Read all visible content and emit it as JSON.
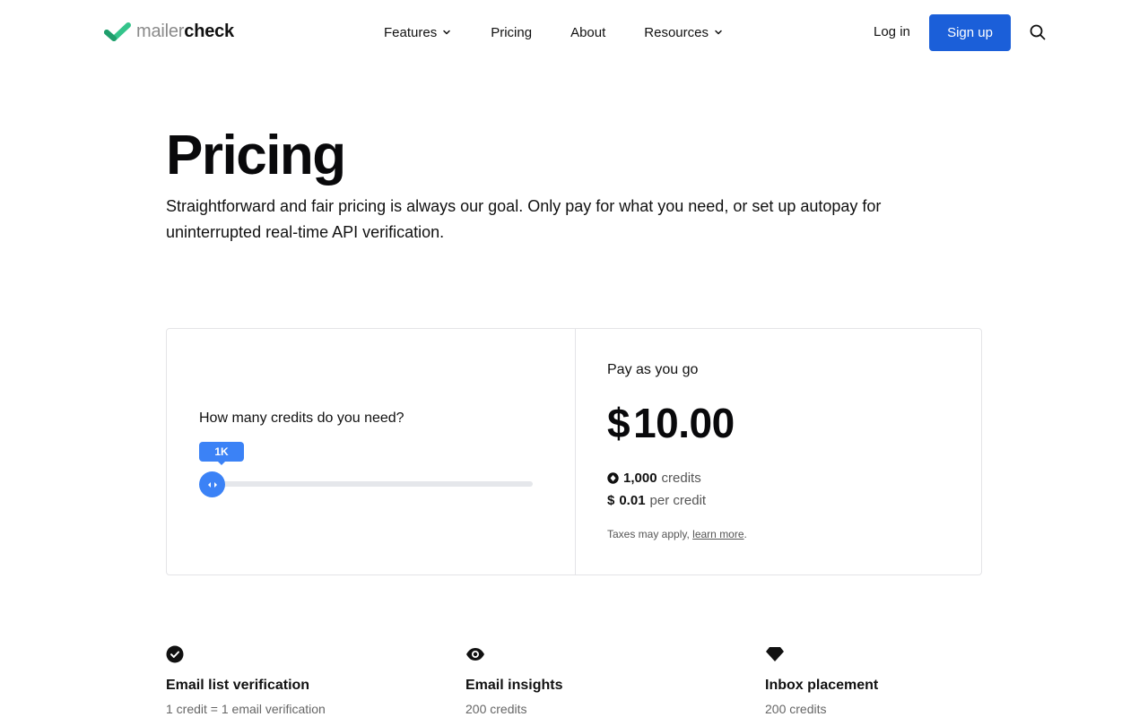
{
  "nav": {
    "logo_light": "mailer",
    "logo_dark": "check",
    "links": [
      {
        "label": "Features",
        "has_dropdown": true
      },
      {
        "label": "Pricing",
        "has_dropdown": false
      },
      {
        "label": "About",
        "has_dropdown": false
      },
      {
        "label": "Resources",
        "has_dropdown": true
      }
    ],
    "login_label": "Log in",
    "signup_label": "Sign up",
    "search_icon": "search-icon"
  },
  "hero": {
    "title": "Pricing",
    "subtitle": "Straightforward and fair pricing is always our goal. Only pay for what you need, or set up autopay for uninterrupted real-time API verification."
  },
  "calculator": {
    "question": "How many credits do you need?",
    "slider": {
      "tooltip": "1K",
      "level_fraction": 0
    },
    "plan_label": "Pay as you go",
    "currency": "$",
    "price": "10.00",
    "credits_value": "1,000",
    "credits_label": "credits",
    "per_credit_currency": "$",
    "per_credit_value": "0.01",
    "per_credit_label": "per credit",
    "tax_note": "Taxes may apply,",
    "tax_link": "learn more",
    "tax_period": "."
  },
  "features": [
    {
      "icon": "check-circle-icon",
      "title": "Email list verification",
      "desc": "1 credit = 1 email verification"
    },
    {
      "icon": "eye-icon",
      "title": "Email insights",
      "desc": "200 credits"
    },
    {
      "icon": "diamond-icon",
      "title": "Inbox placement",
      "desc": "200 credits"
    }
  ],
  "colors": {
    "brand_green": "#34c48b",
    "primary_blue": "#1b5fd9",
    "slider_blue": "#3b82f6"
  }
}
